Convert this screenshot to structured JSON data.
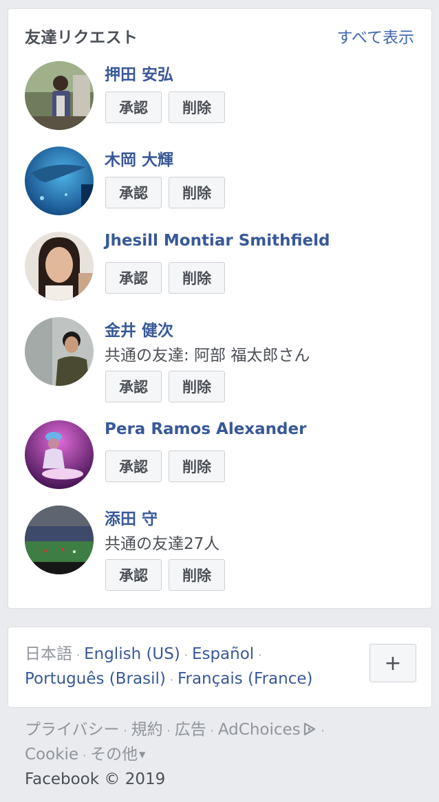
{
  "requests": {
    "title": "友達リクエスト",
    "see_all": "すべて表示",
    "confirm_label": "承認",
    "delete_label": "削除",
    "items": [
      {
        "name": "押田 安弘",
        "mutual": ""
      },
      {
        "name": "木岡 大輝",
        "mutual": ""
      },
      {
        "name": "Jhesill Montiar Smithfield",
        "mutual": ""
      },
      {
        "name": "金井 健次",
        "mutual": "共通の友達: 阿部 福太郎さん"
      },
      {
        "name": "Pera Ramos Alexander",
        "mutual": ""
      },
      {
        "name": "添田 守",
        "mutual": "共通の友達27人"
      }
    ]
  },
  "languages": {
    "current": "日本語",
    "links": [
      "English (US)",
      "Español",
      "Português (Brasil)",
      "Français (France)"
    ],
    "more_label": "+"
  },
  "footer": {
    "links": [
      "プライバシー",
      "規約",
      "広告",
      "AdChoices",
      "Cookie",
      "その他"
    ],
    "copyright": "Facebook © 2019"
  },
  "colors": {
    "link": "#385898",
    "accent": "#4267b2",
    "muted": "#90949c",
    "background": "#e9ebee"
  }
}
